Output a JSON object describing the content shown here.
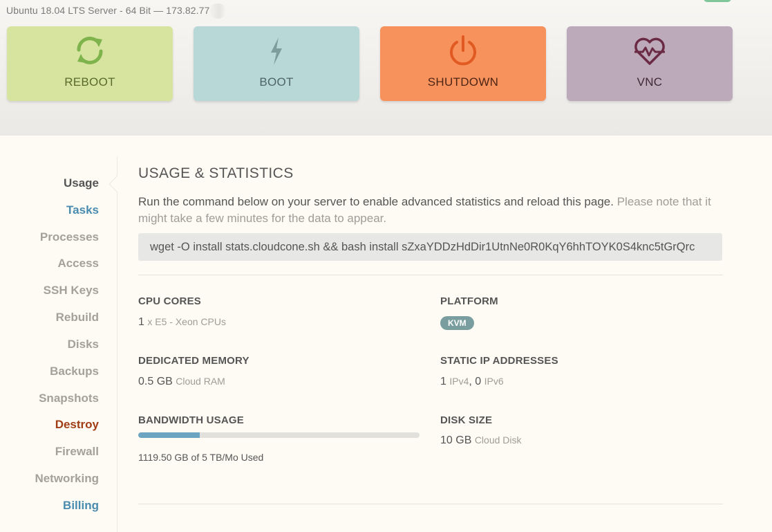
{
  "header": {
    "server_title": "Ubuntu 18.04 LTS Server - 64 Bit — 173.82.77"
  },
  "actions": {
    "reboot": {
      "label": "REBOOT",
      "icon": "refresh-icon",
      "color": "#d6e49f"
    },
    "boot": {
      "label": "BOOT",
      "icon": "lightning-icon",
      "color": "#b8d8d7"
    },
    "shutdown": {
      "label": "SHUTDOWN",
      "icon": "power-icon",
      "color": "#f8925c"
    },
    "vnc": {
      "label": "VNC",
      "icon": "heart-pulse-icon",
      "color": "#bca9ba"
    }
  },
  "sidebar": {
    "items": [
      {
        "label": "Usage",
        "state": "active"
      },
      {
        "label": "Tasks",
        "state": "highlight"
      },
      {
        "label": "Processes"
      },
      {
        "label": "Access"
      },
      {
        "label": "SSH Keys"
      },
      {
        "label": "Rebuild"
      },
      {
        "label": "Disks"
      },
      {
        "label": "Backups"
      },
      {
        "label": "Snapshots"
      },
      {
        "label": "Destroy",
        "state": "danger"
      },
      {
        "label": "Firewall"
      },
      {
        "label": "Networking"
      },
      {
        "label": "Billing",
        "state": "highlight"
      }
    ]
  },
  "main": {
    "title": "USAGE & STATISTICS",
    "intro": "Run the command below on your server to enable advanced statistics and reload this page.",
    "intro_note": "Please note that it might take a few minutes for the data to appear.",
    "command": "wget -O install stats.cloudcone.sh && bash install sZxaYDDzHdDir1UtnNe0R0KqY6hhTOYK0S4knc5tGrQrc",
    "stats": {
      "cpu": {
        "label": "CPU CORES",
        "count": "1",
        "detail": "x E5 - Xeon CPUs"
      },
      "platform": {
        "label": "PLATFORM",
        "badge": "KVM"
      },
      "memory": {
        "label": "DEDICATED MEMORY",
        "amount": "0.5 GB",
        "unit": "Cloud RAM"
      },
      "ip": {
        "label": "STATIC IP ADDRESSES",
        "v4_count": "1",
        "v4_unit": "IPv4",
        "separator": ",",
        "v6_count": "0",
        "v6_unit": "IPv6"
      },
      "bandwidth": {
        "label": "BANDWIDTH USAGE",
        "used_text": "1119.50 GB of 5 TB/Mo Used",
        "fraction_used": 0.219
      },
      "disk": {
        "label": "DISK SIZE",
        "amount": "10 GB",
        "unit": "Cloud Disk"
      }
    }
  },
  "colors": {
    "accent_blue": "#4a8bb0",
    "danger": "#a13d15",
    "progress": "#6ba5c1",
    "badge": "#7a9e9f"
  }
}
